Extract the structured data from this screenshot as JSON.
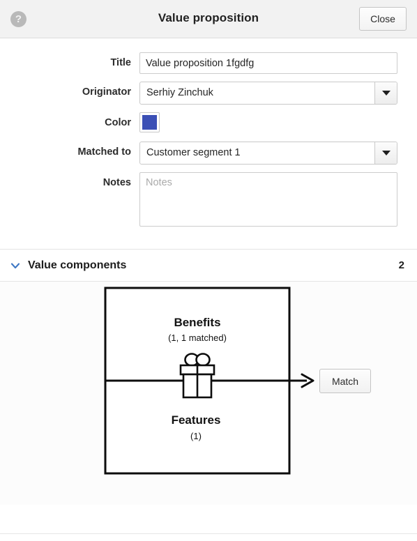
{
  "header": {
    "help_icon": "help-icon",
    "title": "Value proposition",
    "close_label": "Close"
  },
  "form": {
    "title": {
      "label": "Title",
      "value": "Value proposition 1fgdfg",
      "placeholder": "Title"
    },
    "originator": {
      "label": "Originator",
      "value": "Serhiy Zinchuk"
    },
    "color": {
      "label": "Color",
      "value": "#3b4fb5"
    },
    "matched_to": {
      "label": "Matched to",
      "value": "Customer segment 1"
    },
    "notes": {
      "label": "Notes",
      "value": "",
      "placeholder": "Notes"
    }
  },
  "value_components": {
    "chevron_icon": "chevron-down-icon",
    "title": "Value components",
    "count": "2",
    "accent_color": "#3e77c4"
  },
  "diagram": {
    "benefits": {
      "label": "Benefits",
      "sub": "(1, 1 matched)"
    },
    "features": {
      "label": "Features",
      "sub": "(1)"
    },
    "gift_icon": "gift-icon",
    "arrow_icon": "arrow-right-icon",
    "match_button_label": "Match"
  }
}
